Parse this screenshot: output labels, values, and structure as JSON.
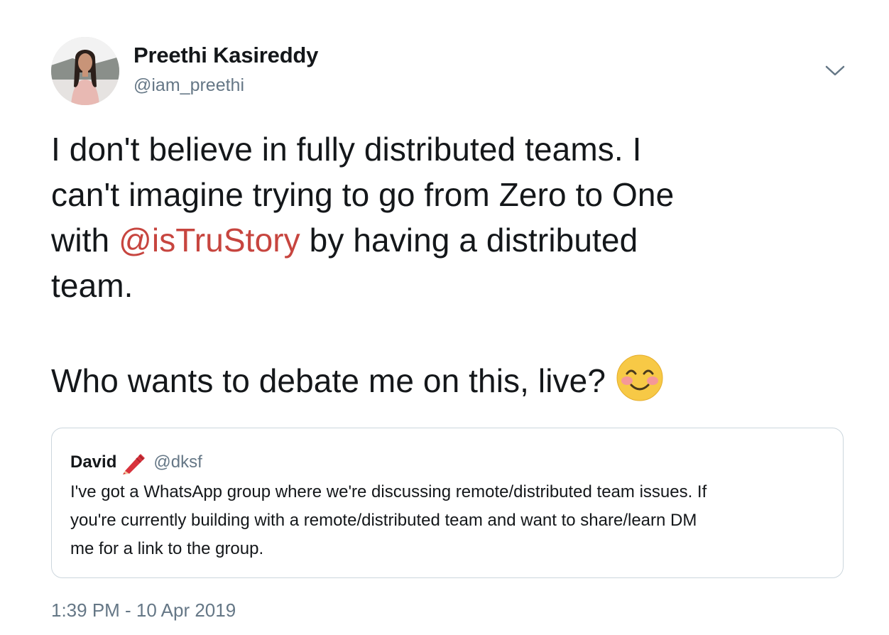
{
  "author": {
    "name": "Preethi Kasireddy",
    "handle": "@iam_preethi"
  },
  "menu_icon": "chevron-down-icon",
  "tweet": {
    "lines": [
      "I don't believe in fully distributed teams. I",
      "can't imagine trying to go from Zero to One",
      "with ",
      "team."
    ],
    "mention": "@isTruStory",
    "line3_after_mention": " by having a distributed",
    "second_paragraph": "Who wants to debate me on this, live?",
    "emoji": "smiling-face-with-smiling-eyes-icon"
  },
  "quoted_tweet": {
    "name": "David",
    "handle": "@dksf",
    "name_emoji": "crayon-icon",
    "lines": [
      "I've got a WhatsApp group where we're discussing remote/distributed team issues. If",
      "you're currently building with a remote/distributed team and want to share/learn DM",
      "me for a link to the group."
    ]
  },
  "timestamp": "1:39 PM - 10 Apr 2019",
  "colors": {
    "mention": "#c7453f",
    "secondary_text": "#657786",
    "border": "#ccd6dd"
  }
}
